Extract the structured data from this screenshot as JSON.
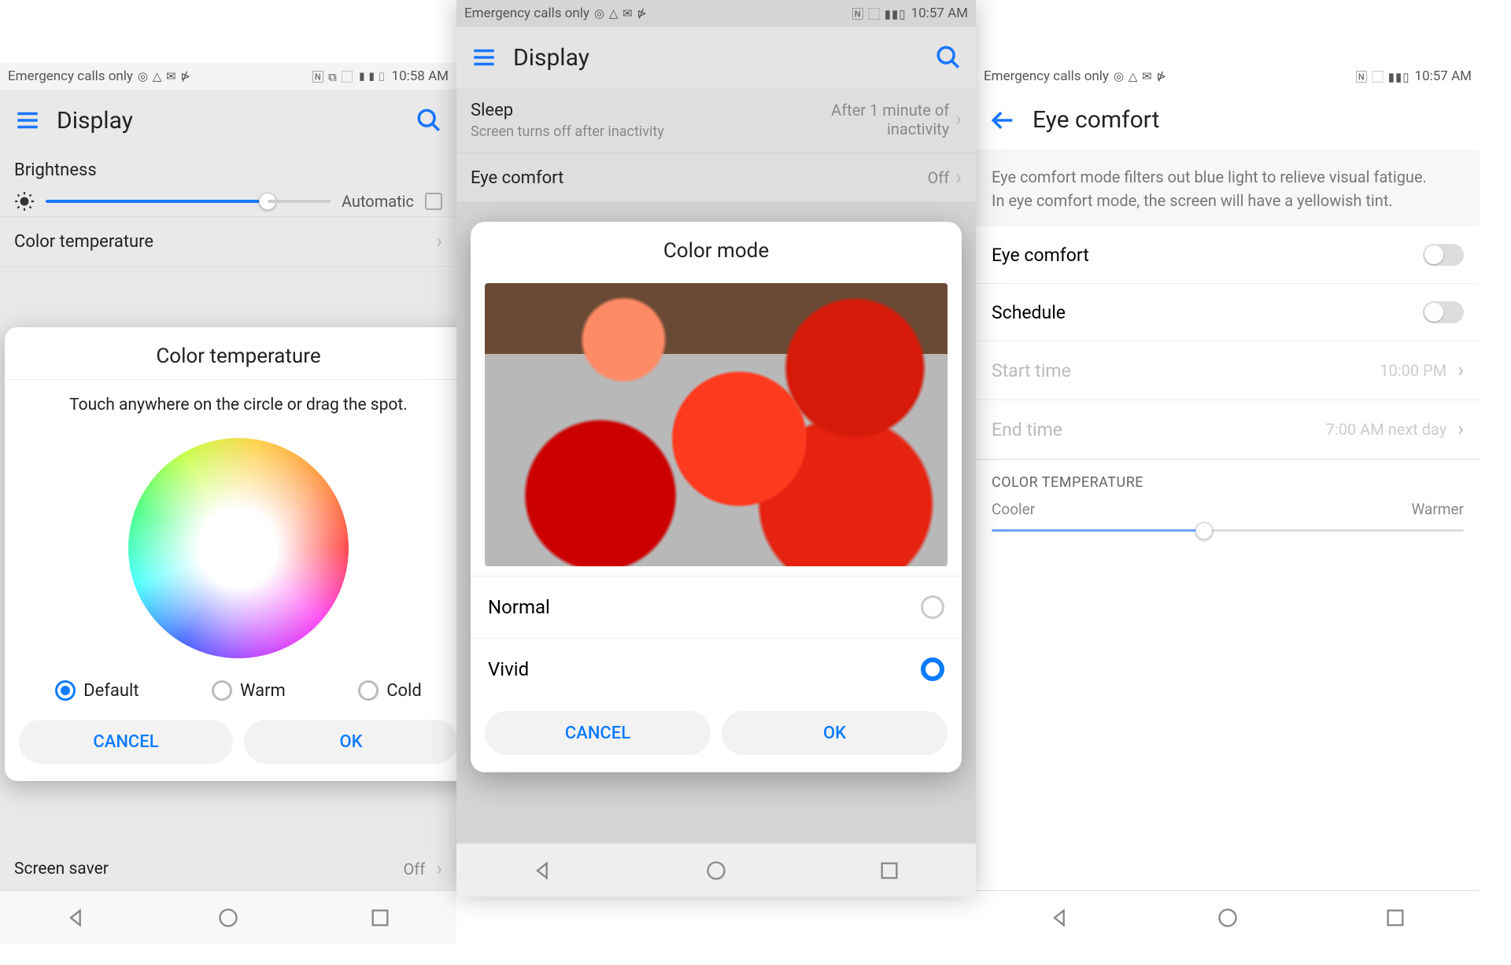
{
  "phone1": {
    "status": {
      "carrier": "Emergency calls only",
      "icons": "◎ △ ✉ ⋫",
      "right_icons": "🄽 ⧉ ⬚ ▮▮▯",
      "time": "10:58 AM"
    },
    "appbar_title": "Display",
    "brightness": {
      "label": "Brightness",
      "auto_label": "Automatic"
    },
    "color_temp_row": "Color temperature",
    "screen_saver_row": {
      "label": "Screen saver",
      "value": "Off"
    },
    "dialog": {
      "title": "Color temperature",
      "subtitle": "Touch anywhere on the circle or drag the spot.",
      "options": {
        "default": "Default",
        "warm": "Warm",
        "cold": "Cold"
      },
      "selected": "default",
      "cancel": "CANCEL",
      "ok": "OK"
    }
  },
  "phone2": {
    "status": {
      "carrier": "Emergency calls only",
      "icons": "◎ △ ✉ ⋫",
      "right_icons": "🄽 ⬚ ▮▮▯",
      "time": "10:57 AM"
    },
    "appbar_title": "Display",
    "sleep": {
      "title": "Sleep",
      "sub": "Screen turns off after inactivity",
      "value": "After 1 minute of inactivity"
    },
    "eyecomfort": {
      "title": "Eye comfort",
      "value": "Off"
    },
    "dialog": {
      "title": "Color mode",
      "normal": "Normal",
      "vivid": "Vivid",
      "selected": "vivid",
      "cancel": "CANCEL",
      "ok": "OK"
    }
  },
  "phone3": {
    "status": {
      "carrier": "Emergency calls only",
      "icons": "◎ △ ✉ ⋫",
      "right_icons": "🄽 ⬚ ▮▮▯",
      "time": "10:57 AM"
    },
    "appbar_title": "Eye comfort",
    "description": "Eye comfort mode filters out blue light to relieve visual fatigue.\nIn eye comfort mode, the screen will have a yellowish tint.",
    "rows": {
      "eyecomfort": "Eye comfort",
      "schedule": "Schedule",
      "start": {
        "label": "Start time",
        "value": "10:00 PM"
      },
      "end": {
        "label": "End time",
        "value": "7:00 AM next day"
      }
    },
    "section": "COLOR TEMPERATURE",
    "cooler": "Cooler",
    "warmer": "Warmer"
  }
}
